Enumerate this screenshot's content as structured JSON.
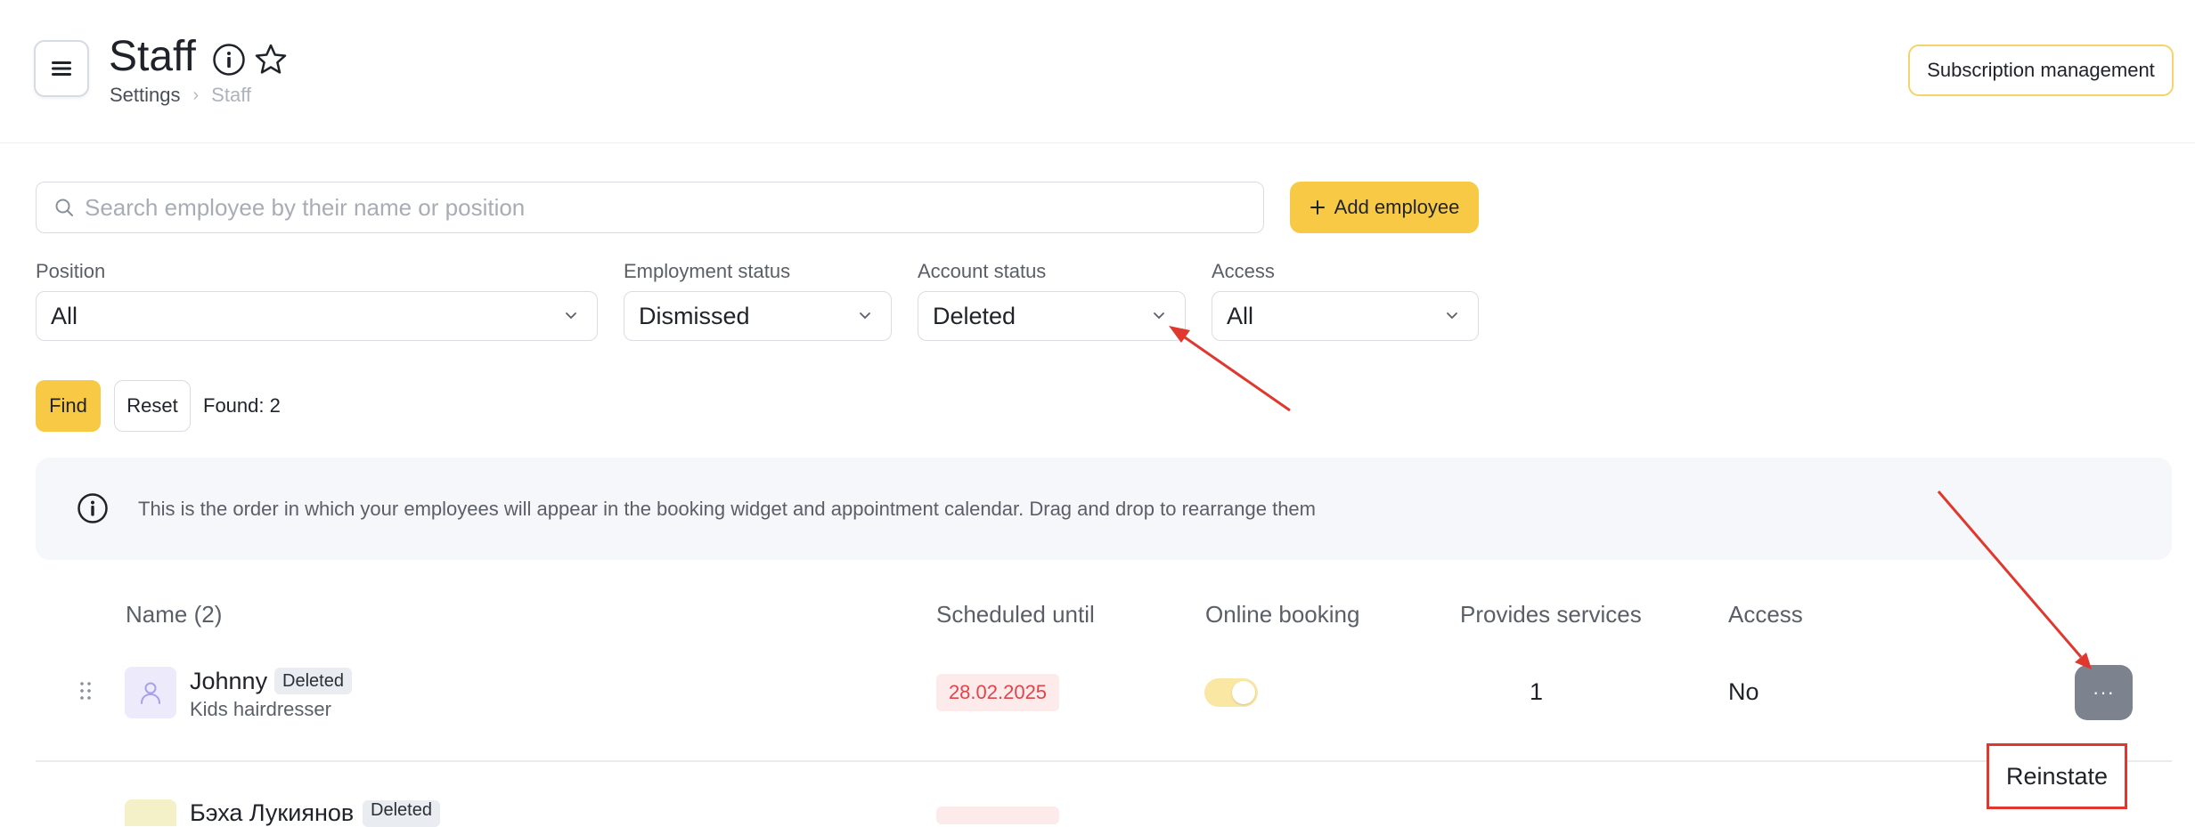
{
  "header": {
    "title": "Staff",
    "breadcrumb": [
      "Settings",
      "Staff"
    ],
    "subscription_button": "Subscription management"
  },
  "search": {
    "placeholder": "Search employee by their name or position",
    "value": ""
  },
  "add_employee_label": "Add employee",
  "filters": {
    "position": {
      "label": "Position",
      "value": "All"
    },
    "employment_status": {
      "label": "Employment status",
      "value": "Dismissed"
    },
    "account_status": {
      "label": "Account status",
      "value": "Deleted"
    },
    "access": {
      "label": "Access",
      "value": "All"
    }
  },
  "actions": {
    "find": "Find",
    "reset": "Reset",
    "found": "Found: 2"
  },
  "info_text": "This is the order in which your employees will appear in the booking widget and appointment calendar. Drag and drop to rearrange them",
  "table": {
    "headers": {
      "name": "Name (2)",
      "scheduled_until": "Scheduled until",
      "online_booking": "Online booking",
      "provides_services": "Provides services",
      "access": "Access"
    },
    "rows": [
      {
        "name": "Johnny",
        "badge": "Deleted",
        "position": "Kids hairdresser",
        "scheduled_until": "28.02.2025",
        "online_booking": true,
        "provides_services": "1",
        "access": "No",
        "more": "···"
      },
      {
        "name": "Бэха Лукиянов",
        "badge": "Deleted"
      }
    ]
  },
  "context_menu": {
    "reinstate": "Reinstate"
  },
  "colors": {
    "accent": "#f7c944",
    "annotation": "#e0372e",
    "deleted_date": "#e0454a"
  },
  "icons": [
    "menu-icon",
    "info-icon",
    "star-icon",
    "search-icon",
    "plus-icon",
    "chevron-down-icon",
    "drag-handle-icon",
    "user-icon"
  ]
}
